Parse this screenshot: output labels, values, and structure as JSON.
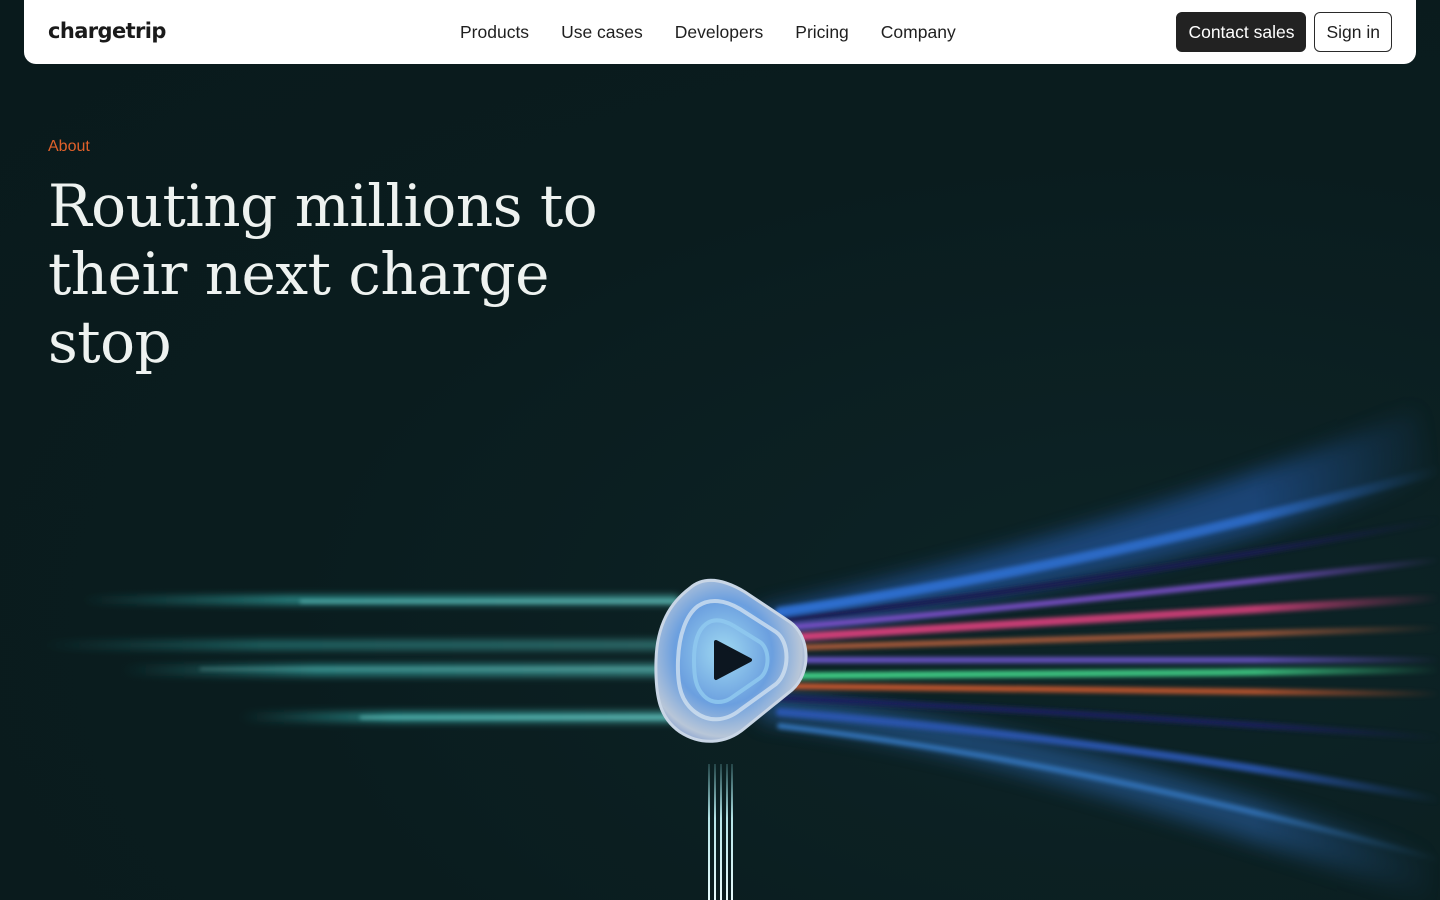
{
  "header": {
    "logo": "chargetrip",
    "nav": [
      "Products",
      "Use cases",
      "Developers",
      "Pricing",
      "Company"
    ],
    "contact_label": "Contact sales",
    "signin_label": "Sign in"
  },
  "hero": {
    "eyebrow": "About",
    "headline_line1": "Routing millions to",
    "headline_line2": "their next charge stop"
  },
  "colors": {
    "background": "#0a1c1e",
    "accent": "#e0612a",
    "headline": "#eef2f0",
    "button_dark": "#222222"
  },
  "icons": {
    "logo_badge": "play-triangle-icon"
  }
}
